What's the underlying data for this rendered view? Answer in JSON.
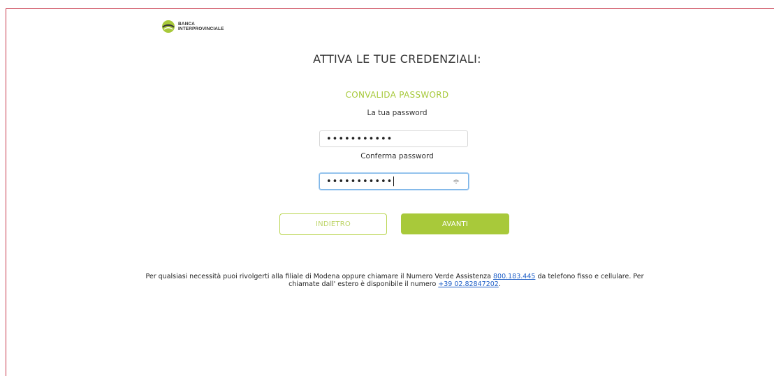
{
  "brand": {
    "logo_line1": "BANCA",
    "logo_line2": "INTERPROVINCIALE"
  },
  "page": {
    "title": "ATTIVA LE TUE CREDENZIALI:",
    "subtitle": "CONVALIDA PASSWORD"
  },
  "form": {
    "password_label": "La tua password",
    "password_value": "•••••••••••",
    "confirm_label": "Conferma password",
    "confirm_value": "•••••••••••"
  },
  "buttons": {
    "back": "INDIETRO",
    "next": "AVANTI"
  },
  "footer": {
    "text_part1": "Per qualsiasi necessità puoi rivolgerti alla filiale di Modena oppure chiamare il Numero Verde Assistenza ",
    "phone_green": "800.183.445",
    "text_part2": " da telefono fisso e cellulare. Per",
    "text_part3": "chiamate dall' estero è disponibile il numero ",
    "phone_abroad": "+39 02.82847202",
    "text_part4": "."
  },
  "colors": {
    "accent": "#a8c93a",
    "frame": "#c8374a",
    "link": "#1f5fc7"
  },
  "icons": [
    "bank-logo-icon",
    "show-password-icon"
  ]
}
